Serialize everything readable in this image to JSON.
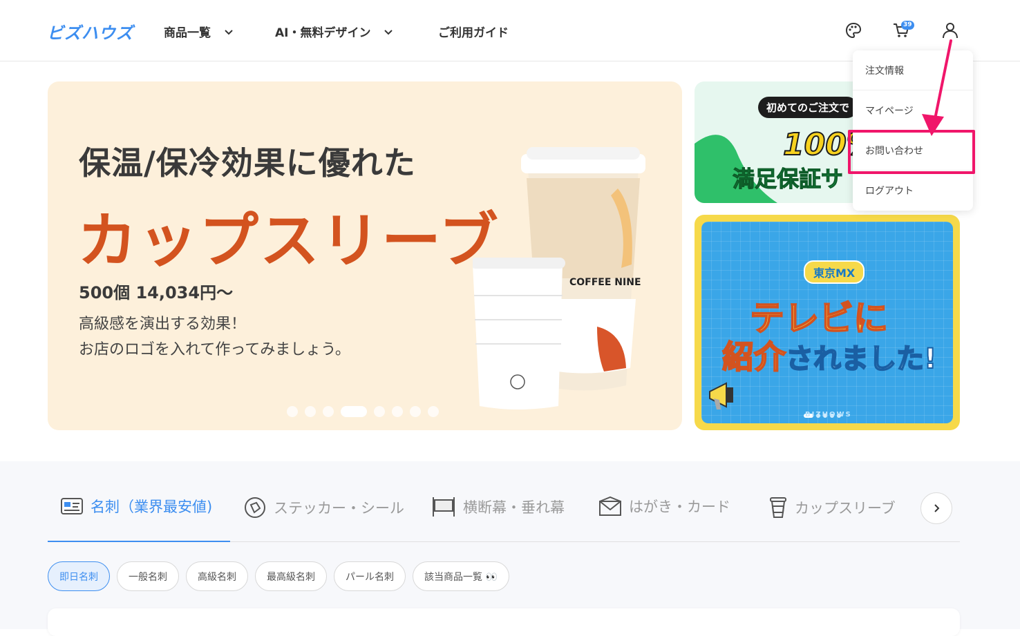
{
  "header": {
    "logo": "ビズハウズ",
    "nav": [
      {
        "label": "商品一覧"
      },
      {
        "label": "AI・無料デザイン"
      },
      {
        "label": "ご利用ガイド"
      }
    ],
    "cart_count": "39",
    "icons": [
      "palette-icon",
      "cart-icon",
      "user-icon"
    ]
  },
  "user_menu": {
    "items": [
      {
        "label": "注文情報"
      },
      {
        "label": "マイページ"
      },
      {
        "label": "お問い合わせ"
      },
      {
        "label": "ログアウト"
      }
    ],
    "highlight_color": "#f0166a"
  },
  "hero": {
    "headline": "保温/保冷効果に優れた",
    "title": "カップスリーブ",
    "price": "500個 14,034円〜",
    "desc_line1": "高級感を演出する効果！",
    "desc_line2": "お店のロゴを入れて作ってみましょう。",
    "cup_label": "COFFEE NINE",
    "slides_total": 8,
    "active_slide": 4
  },
  "side_banner_top": {
    "pill": "初めてのご注文で",
    "percent": "100%",
    "text": "満足保証サ"
  },
  "side_banner_bottom": {
    "badge": "東京MX",
    "line1": "テレビに",
    "line2_big": "紹介",
    "line2_rest": "されました!",
    "brand": "BIZHOWS"
  },
  "category_tabs": [
    {
      "label": "名刺（業界最安値)",
      "icon": "business-card-icon"
    },
    {
      "label": "ステッカー・シール",
      "icon": "sticker-icon"
    },
    {
      "label": "横断幕・垂れ幕",
      "icon": "banner-icon"
    },
    {
      "label": "はがき・カード",
      "icon": "envelope-icon"
    },
    {
      "label": "カップスリーブ",
      "icon": "cup-icon"
    }
  ],
  "sub_chips": [
    {
      "label": "即日名刺"
    },
    {
      "label": "一般名刺"
    },
    {
      "label": "高級名刺"
    },
    {
      "label": "最高級名刺"
    },
    {
      "label": "パール名刺"
    },
    {
      "label": "該当商品一覧 👀"
    }
  ],
  "colors": {
    "brand": "#3d8ef0",
    "hero_bg": "#fdf0db",
    "hero_accent": "#d3531f"
  }
}
